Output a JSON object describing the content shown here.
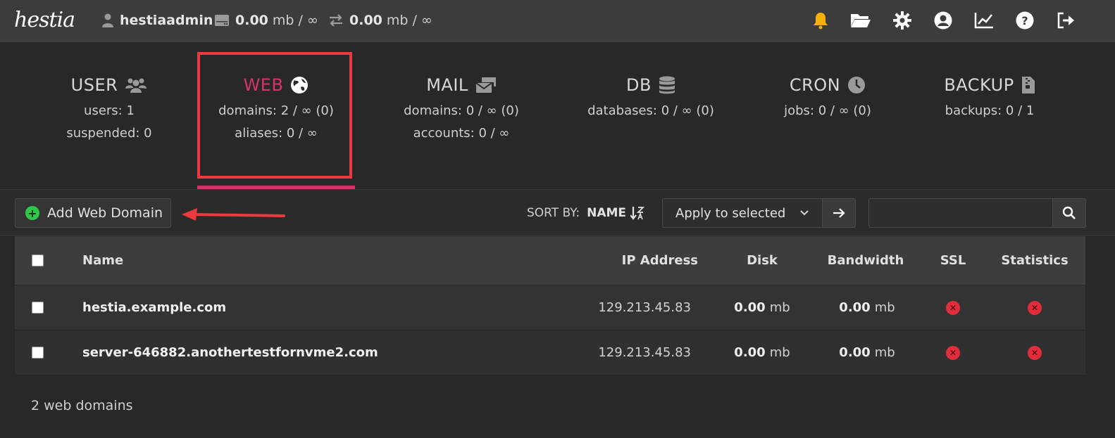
{
  "app": {
    "logo_text": "hestia"
  },
  "topbar": {
    "username": "hestiaadmin",
    "disk_value": "0.00",
    "disk_suffix": "mb / ∞",
    "bandwidth_value": "0.00",
    "bandwidth_suffix": "mb / ∞",
    "icons": [
      "user-icon",
      "server-icon",
      "transfer-icon",
      "bell-icon",
      "folder-icon",
      "gear-icon",
      "user-circle-icon",
      "chart-icon",
      "help-icon",
      "logout-icon"
    ]
  },
  "stats": {
    "user": {
      "title": "USER",
      "line1": "users: 1",
      "line2": "suspended: 0"
    },
    "web": {
      "title": "WEB",
      "line1": "domains: 2 / ∞ (0)",
      "line2": "aliases: 0 / ∞"
    },
    "mail": {
      "title": "MAIL",
      "line1": "domains: 0 / ∞ (0)",
      "line2": "accounts: 0 / ∞"
    },
    "db": {
      "title": "DB",
      "line1": "databases: 0 / ∞ (0)"
    },
    "cron": {
      "title": "CRON",
      "line1": "jobs: 0 / ∞ (0)"
    },
    "backup": {
      "title": "BACKUP",
      "line1": "backups: 0 / 1"
    }
  },
  "toolbar": {
    "add_label": "Add Web Domain",
    "sort_label": "SORT BY:",
    "sort_value": "NAME",
    "apply_selected": "Apply to selected",
    "search_placeholder": ""
  },
  "table": {
    "headers": {
      "name": "Name",
      "ip": "IP Address",
      "disk": "Disk",
      "bandwidth": "Bandwidth",
      "ssl": "SSL",
      "stats": "Statistics"
    },
    "rows": [
      {
        "name": "hestia.example.com",
        "ip": "129.213.45.83",
        "disk_value": "0.00",
        "disk_unit": "mb",
        "bw_value": "0.00",
        "bw_unit": "mb",
        "ssl": "disabled",
        "stats": "disabled"
      },
      {
        "name": "server-646882.anothertestfornvme2.com",
        "ip": "129.213.45.83",
        "disk_value": "0.00",
        "disk_unit": "mb",
        "bw_value": "0.00",
        "bw_unit": "mb",
        "ssl": "disabled",
        "stats": "disabled"
      }
    ]
  },
  "footer": {
    "count_text": "2 web domains"
  },
  "colors": {
    "accent": "#d6336c",
    "highlight": "#ee3a3f",
    "add_icon": "#2fc84a",
    "disabled": "#e02c3b",
    "bell": "#f5b10a"
  }
}
